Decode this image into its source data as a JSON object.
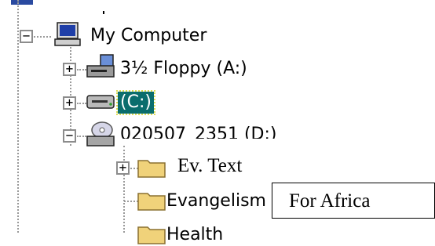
{
  "tree": {
    "items": [
      {
        "label": "My Computer",
        "expander": "−"
      },
      {
        "label": "3½ Floppy (A:)",
        "expander": "+"
      },
      {
        "label": "(C:)",
        "expander": "+"
      },
      {
        "label": "020507_2351 (D:)",
        "expander": "−"
      },
      {
        "label": "",
        "expander": "+"
      },
      {
        "label": "Evangelism"
      },
      {
        "label": "Health"
      }
    ]
  },
  "overlay": {
    "ev_text": "Ev. Text",
    "for_africa": "For Africa"
  },
  "colors": {
    "selection": "#0a6d6d",
    "folder": "#f0d27a"
  }
}
